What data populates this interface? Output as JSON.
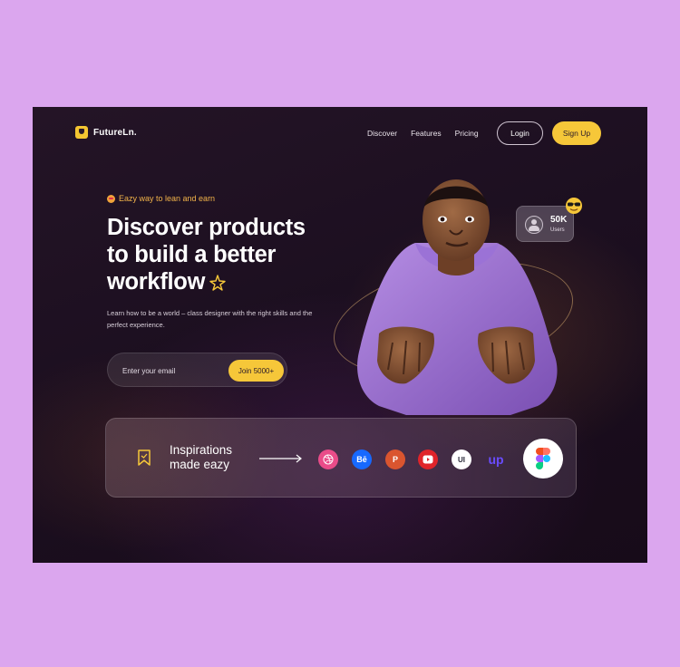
{
  "brand": {
    "name": "FutureLn."
  },
  "nav": [
    {
      "label": "Discover"
    },
    {
      "label": "Features"
    },
    {
      "label": "Pricing"
    }
  ],
  "auth": {
    "login_label": "Login",
    "signup_label": "Sign Up"
  },
  "hero": {
    "tagline": "Eazy way to lean and earn",
    "headline_lines": [
      "Discover products",
      "to build a better",
      "workflow"
    ],
    "description": "Learn how to be a world – class designer  with the right skills and the perfect experience."
  },
  "signup_form": {
    "placeholder": "Enter your email",
    "button_label": "Join 5000+"
  },
  "users_badge": {
    "count": "50K",
    "label": "Users"
  },
  "inspirations": {
    "title_lines": [
      "Inspirations",
      "made eazy"
    ],
    "brands": [
      {
        "name": "dribbble-icon",
        "glyph": "",
        "color": "#ea4c89"
      },
      {
        "name": "behance-icon",
        "glyph": "Bē",
        "color": "#1769ff"
      },
      {
        "name": "producthunt-icon",
        "glyph": "P",
        "color": "#da552f"
      },
      {
        "name": "youtube-icon",
        "glyph": "",
        "color": "#e0242a"
      },
      {
        "name": "uplabs-icon",
        "glyph": "UI",
        "color": "#ffffff"
      },
      {
        "name": "upwork-icon",
        "glyph": "up",
        "color": "#6a4cff"
      }
    ]
  },
  "colors": {
    "accent": "#f6c739",
    "background": "#1c0f20",
    "page": "#dba6ee"
  }
}
